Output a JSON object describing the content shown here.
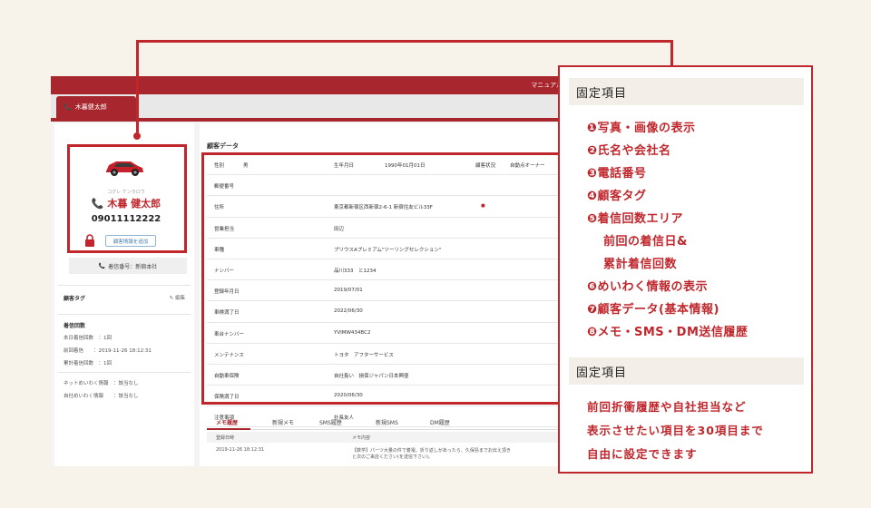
{
  "app": {
    "manual_label": "マニュアル",
    "customer_tab": "木暮健太郎",
    "left": {
      "ruby": "コグレ ケンタロウ",
      "name": "木暮 健太郎",
      "phone": "09011112222",
      "add_button": "顧客情報を追加",
      "incoming_label": "着信番号：新宿本社",
      "tag_title": "顧客タグ",
      "tag_edit": "編集",
      "stats_title": "着信回数",
      "stats": [
        "本日着信回数　：1回",
        "前回着信　　：2019-11-26 18:12:31",
        "累計着信回数　：1回"
      ],
      "waku": [
        "ネットめいわく情報　：該当なし",
        "自社めいわく情報　　：該当なし"
      ]
    },
    "right": {
      "title": "顧客データ",
      "rows": [
        {
          "label": "性別",
          "value": "男",
          "label2": "生年月日",
          "value2": "1990年01月01日",
          "label3": "顧客状況",
          "value3": "自動点オーナー"
        },
        {
          "label": "郵便番号",
          "value": ""
        },
        {
          "label": "住所",
          "value": "東京都新宿区西新宿2-6-1 新宿住友ビル33F"
        },
        {
          "label": "営業担当",
          "value": "田辺"
        },
        {
          "label": "車種",
          "value": "プリウスAプレミアム\"ツーリングセレクション\""
        },
        {
          "label": "ナンバー",
          "value": "品川333　と1234"
        },
        {
          "label": "登録年月日",
          "value": "2019/07/01"
        },
        {
          "label": "車検満了日",
          "value": "2022/06/30"
        },
        {
          "label": "車台ナンバー",
          "value": "YVIMW434BC2"
        },
        {
          "label": "メンテナンス",
          "value": "トヨタ　アフターサービス"
        },
        {
          "label": "自動車保険",
          "value": "自社扱い　損保ジャパン日本興亜"
        },
        {
          "label": "保険満了日",
          "value": "2020/06/30"
        },
        {
          "label": "注意事項",
          "value": "社長友人"
        }
      ],
      "memo_tabs": [
        "メモ履歴",
        "新規メモ",
        "SMS履歴",
        "新規SMS",
        "DM履歴"
      ],
      "memo_head": {
        "col1": "登録日時",
        "col2": "メモ内容"
      },
      "memo_row": {
        "date": "2019-11-26 18:12:31",
        "text": "【数学】パーツ大量の件で着電。折り返しがあったら、久保島までお伝え頂き",
        "text2": "と次のご来店ください(を送信下さい)。"
      }
    }
  },
  "info": {
    "fixed_title": "固定項目",
    "features": [
      "❶写真・画像の表示",
      "❷氏名や会社名",
      "❸電話番号",
      "❹顧客タグ",
      "❺着信回数エリア",
      "前回の着信日&",
      "累計着信回数",
      "❻めいわく情報の表示",
      "❼顧客データ(基本情報)",
      "❽メモ・SMS・DM送信履歴"
    ],
    "custom_title": "固定項目",
    "description": [
      "前回折衝履歴や自社担当など",
      "表示させたい項目を30項目まで",
      "自由に設定できます"
    ]
  },
  "colors": {
    "accent": "#c0272d",
    "topbar": "#a8262d",
    "panel_head_bg": "#f3eee7",
    "background": "#f7f2ea"
  }
}
